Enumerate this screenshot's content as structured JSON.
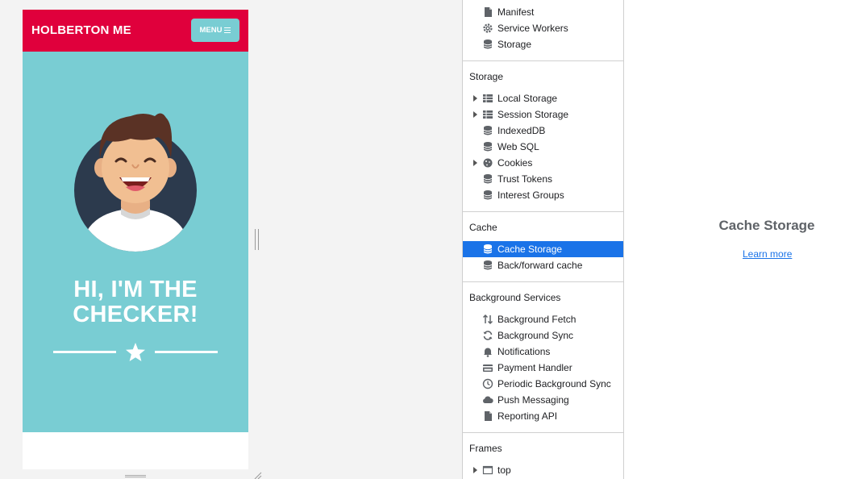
{
  "device": {
    "logo": "HOLBERTON ME",
    "menu_label": "MENU",
    "hero_title_line1": "HI, I'M THE",
    "hero_title_line2": "CHECKER!"
  },
  "sidebar": {
    "app_items": [
      {
        "label": "Manifest",
        "icon": "document-icon"
      },
      {
        "label": "Service Workers",
        "icon": "gear-icon"
      },
      {
        "label": "Storage",
        "icon": "database-icon"
      }
    ],
    "storage_title": "Storage",
    "storage_items": [
      {
        "label": "Local Storage",
        "icon": "grid-icon",
        "expandable": true
      },
      {
        "label": "Session Storage",
        "icon": "grid-icon",
        "expandable": true
      },
      {
        "label": "IndexedDB",
        "icon": "database-icon"
      },
      {
        "label": "Web SQL",
        "icon": "database-icon"
      },
      {
        "label": "Cookies",
        "icon": "cookie-icon",
        "expandable": true
      },
      {
        "label": "Trust Tokens",
        "icon": "database-icon"
      },
      {
        "label": "Interest Groups",
        "icon": "database-icon"
      }
    ],
    "cache_title": "Cache",
    "cache_items": [
      {
        "label": "Cache Storage",
        "icon": "database-icon",
        "selected": true
      },
      {
        "label": "Back/forward cache",
        "icon": "database-icon"
      }
    ],
    "bg_title": "Background Services",
    "bg_items": [
      {
        "label": "Background Fetch",
        "icon": "arrows-updown-icon"
      },
      {
        "label": "Background Sync",
        "icon": "sync-icon"
      },
      {
        "label": "Notifications",
        "icon": "bell-icon"
      },
      {
        "label": "Payment Handler",
        "icon": "card-icon"
      },
      {
        "label": "Periodic Background Sync",
        "icon": "clock-icon"
      },
      {
        "label": "Push Messaging",
        "icon": "cloud-icon"
      },
      {
        "label": "Reporting API",
        "icon": "document-icon"
      }
    ],
    "frames_title": "Frames",
    "frames_items": [
      {
        "label": "top",
        "icon": "frame-icon",
        "expandable": true
      }
    ]
  },
  "main": {
    "title": "Cache Storage",
    "learn_more": "Learn more"
  },
  "colors": {
    "brand_red": "#e0003c",
    "hero_teal": "#79cdd3",
    "selected_blue": "#1a73e8"
  }
}
